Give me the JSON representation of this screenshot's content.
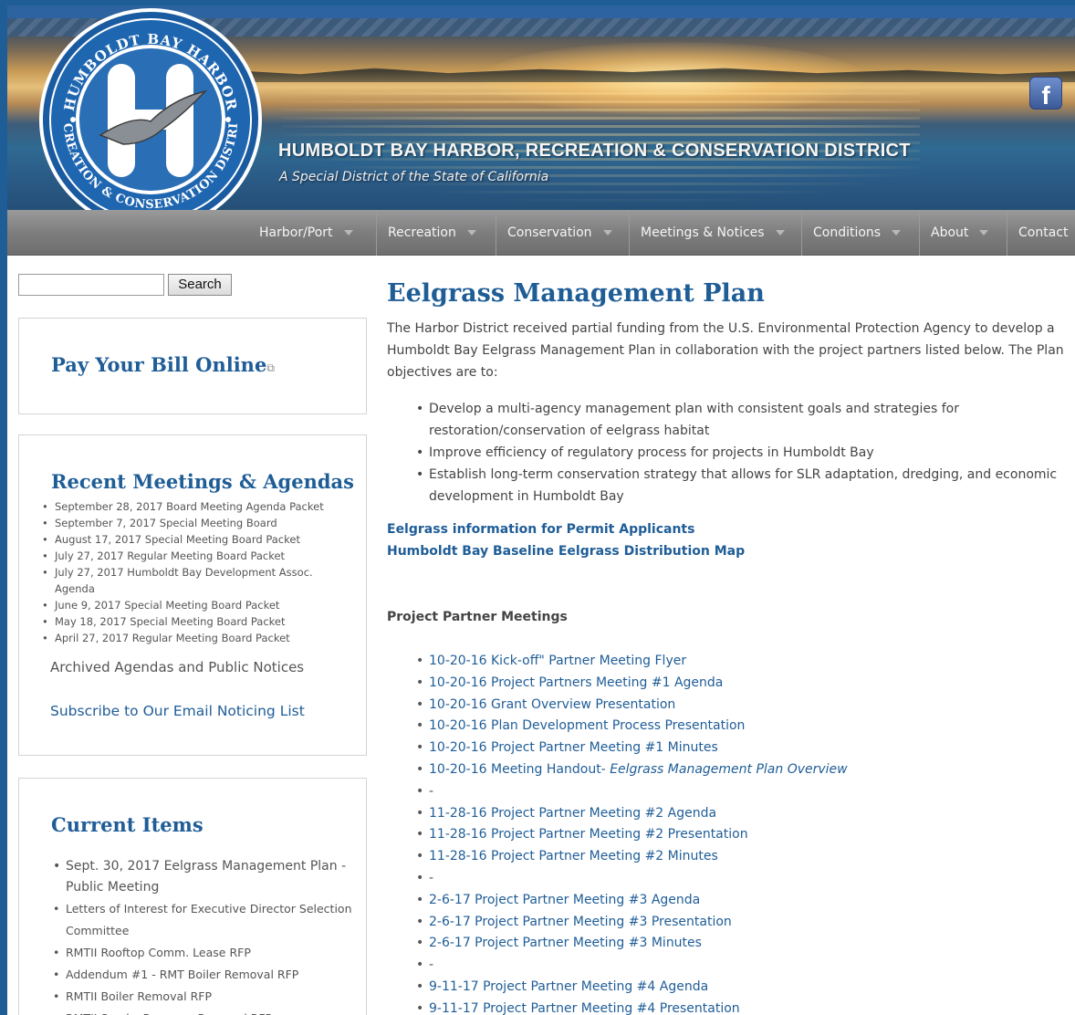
{
  "header": {
    "site_title": "HUMBOLDT BAY  HARBOR, RECREATION  & CONSERVATION DISTRICT",
    "site_subtitle": "A Special District of the State of California",
    "logo_top_text": "HUMBOLDT BAY HARBOR",
    "logo_bottom_text": "RECREATION & CONSERVATION DISTRICT",
    "facebook_label": "f"
  },
  "nav": {
    "items": [
      {
        "label": "Harbor/Port"
      },
      {
        "label": "Recreation"
      },
      {
        "label": "Conservation"
      },
      {
        "label": "Meetings & Notices"
      },
      {
        "label": "Conditions"
      },
      {
        "label": "About"
      },
      {
        "label": "Contact"
      }
    ]
  },
  "sidebar": {
    "search": {
      "placeholder": "",
      "button_label": "Search"
    },
    "pay_bill": {
      "title": "Pay Your Bill Online",
      "ext_icon": "⧉"
    },
    "recent_meetings": {
      "title": "Recent Meetings & Agendas",
      "items": [
        "September 28, 2017 Board Meeting Agenda Packet",
        "September 7, 2017 Special Meeting Board",
        "August 17, 2017 Special Meeting Board Packet",
        "July 27, 2017 Regular Meeting Board Packet",
        "July 27, 2017 Humboldt Bay Development Assoc. Agenda",
        "June 9, 2017 Special Meeting Board Packet",
        "May 18, 2017 Special Meeting Board Packet",
        "April 27, 2017 Regular Meeting Board Packet"
      ],
      "archived_link": "Archived Agendas and Public Notices",
      "subscribe_link": "Subscribe to Our Email Noticing List"
    },
    "current_items": {
      "title": "Current Items",
      "items": [
        "Sept. 30, 2017 Eelgrass Management Plan - Public Meeting",
        "Letters of Interest for Executive Director Selection Committee",
        "RMTII Rooftop Comm. Lease RFP",
        "Addendum #1 - RMT Boiler Removal RFP",
        "RMTII Boiler Removal RFP",
        "RMTII Smoke Remover Removal RFP"
      ]
    }
  },
  "main": {
    "title": "Eelgrass Management Plan",
    "intro": "The Harbor District received partial funding from the U.S. Environmental Protection Agency to develop a Humboldt Bay Eelgrass Management Plan in collaboration with the project partners listed below. The Plan objectives are to:",
    "objectives": [
      "Develop a multi-agency management plan with consistent goals and strategies for restoration/conservation of eelgrass habitat",
      "Improve efficiency of regulatory process for projects in Humboldt Bay",
      "Establish long-term conservation strategy that allows for SLR adaptation, dredging, and economic development in Humboldt Bay"
    ],
    "link_permit": "Eelgrass information for Permit Applicants",
    "link_map": "Humboldt Bay Baseline Eelgrass Distribution Map",
    "section_head": "Project Partner Meetings",
    "partner_meetings": {
      "item_0": "10-20-16 Kick-off\" Partner Meeting Flyer",
      "item_1": "10-20-16 Project Partners Meeting #1 Agenda",
      "item_2": "10-20-16 Grant Overview Presentation",
      "item_3": "10-20-16 Plan Development Process Presentation",
      "item_4": "10-20-16 Project Partner Meeting #1 Minutes",
      "item_5_prefix": "10-20-16 Meeting Handout- ",
      "item_5_em": "Eelgrass Management Plan Overview",
      "sep_1": "-",
      "item_6": "11-28-16 Project Partner Meeting #2 Agenda",
      "item_7": "11-28-16 Project Partner Meeting #2 Presentation",
      "item_8": "11-28-16 Project Partner Meeting #2 Minutes",
      "sep_2": "-",
      "item_9": "2-6-17 Project Partner Meeting #3 Agenda",
      "item_10": "2-6-17 Project Partner Meeting #3 Presentation",
      "item_11": "2-6-17 Project Partner Meeting #3 Minutes",
      "sep_3": "-",
      "item_12": "9-11-17 Project Partner Meeting #4 Agenda",
      "item_13": "9-11-17 Project Partner Meeting #4 Presentation"
    }
  },
  "colors": {
    "outer_frame": "#1f5d97",
    "heading_blue": "#1f5d97",
    "body_text": "#444444",
    "nav_bg": "#7e7e7e"
  }
}
